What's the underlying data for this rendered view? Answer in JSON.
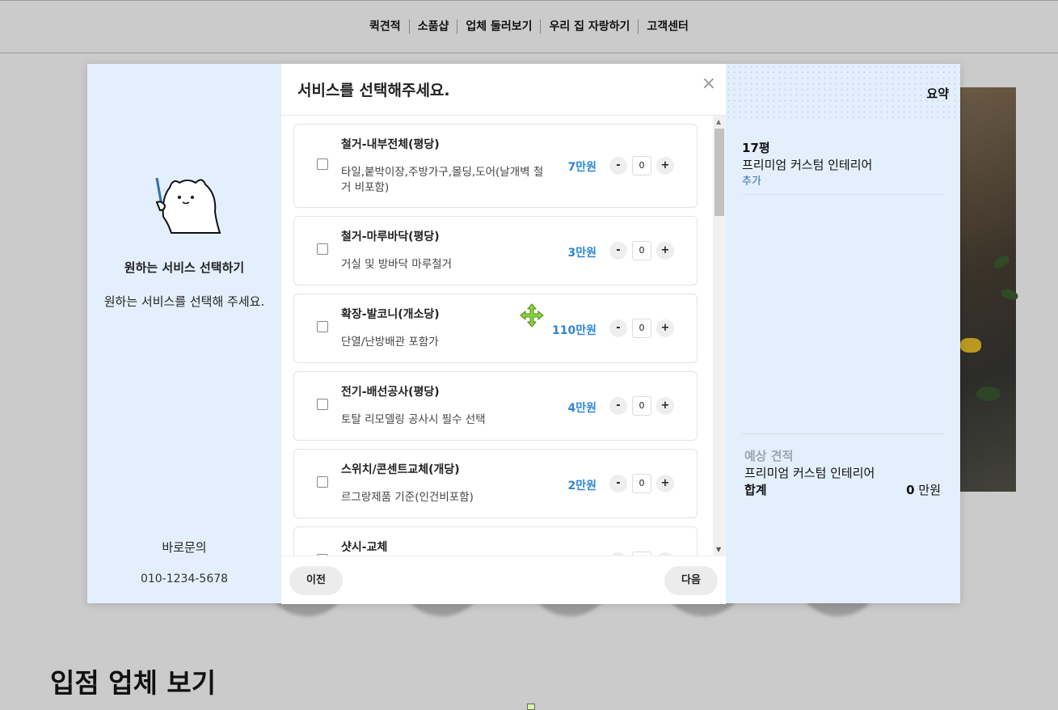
{
  "nav": {
    "items": [
      {
        "label": "퀵견적"
      },
      {
        "label": "소품샵"
      },
      {
        "label": "업체 둘러보기"
      },
      {
        "label": "우리 집 자랑하기"
      },
      {
        "label": "고객센터"
      }
    ]
  },
  "background": {
    "section_title": "입점 업체 보기"
  },
  "left": {
    "title": "원하는 서비스 선택하기",
    "description": "원하는 서비스를 선택해 주세요.",
    "contact_label": "바로문의",
    "contact_phone": "010-1234-5678"
  },
  "modal": {
    "title": "서비스를 선택해주세요.",
    "close": "×",
    "prev_label": "이전",
    "next_label": "다음"
  },
  "services": [
    {
      "name": "철거-내부전체(평당)",
      "desc": "타일,붙박이장,주방가구,몰딩,도어(날개벽 철거 비포함)",
      "price": "7만원",
      "qty": "0",
      "minus": "-",
      "plus": "+"
    },
    {
      "name": "철거-마루바닥(평당)",
      "desc": "거실 및 방바닥 마루철거",
      "price": "3만원",
      "qty": "0",
      "minus": "-",
      "plus": "+"
    },
    {
      "name": "확장-발코니(개소당)",
      "desc": "단열/난방배관 포함가",
      "price": "110만원",
      "qty": "0",
      "minus": "-",
      "plus": "+"
    },
    {
      "name": "전기-배선공사(평당)",
      "desc": "토탈 리모델링 공사시 필수 선택",
      "price": "4만원",
      "qty": "0",
      "minus": "-",
      "plus": "+"
    },
    {
      "name": "스위치/콘센트교체(개당)",
      "desc": "르그랑제품 기준(인건비포함)",
      "price": "2만원",
      "qty": "0",
      "minus": "-",
      "plus": "+"
    },
    {
      "name": "샷시-교체",
      "desc": "",
      "price": "",
      "qty": "",
      "minus": "",
      "plus": ""
    }
  ],
  "summary": {
    "title": "요약",
    "size": "17평",
    "plan": "프리미엄 커스텀 인테리어",
    "add": "추가",
    "estimate_label": "예상 견적",
    "estimate_plan": "프리미엄 커스텀 인테리어",
    "total_label": "합계",
    "total_amount": "0",
    "total_unit": "만원"
  },
  "icons": {
    "move": "move-cursor-icon",
    "mascot": "mascot-icon",
    "close": "close-icon"
  },
  "colors": {
    "accent_price": "#2f86d6",
    "panel_bg": "#e3effc",
    "overlay_bg": "#cbcbcb"
  }
}
